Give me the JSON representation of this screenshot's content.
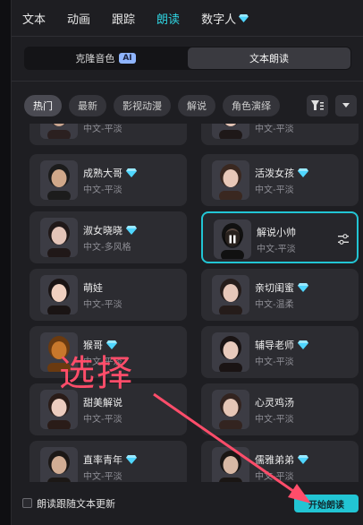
{
  "tabs": [
    {
      "label": "文本",
      "active": false
    },
    {
      "label": "动画",
      "active": false
    },
    {
      "label": "跟踪",
      "active": false
    },
    {
      "label": "朗读",
      "active": true
    },
    {
      "label": "数字人",
      "active": false,
      "premium_icon": "diamond-icon"
    }
  ],
  "segment": {
    "clone_label": "克隆音色",
    "ai_badge": "AI",
    "tts_label": "文本朗读",
    "active": "文本朗读"
  },
  "chips": [
    "热门",
    "最新",
    "影视动漫",
    "解说",
    "角色演绎"
  ],
  "voices": [
    {
      "name": "",
      "sub": "中文-平淡",
      "premium": false,
      "avatar": "female-1",
      "partial": true
    },
    {
      "name": "",
      "sub": "中文-平淡",
      "premium": false,
      "avatar": "female-2",
      "partial": true
    },
    {
      "name": "成熟大哥",
      "sub": "中文-平淡",
      "premium": true,
      "avatar": "male-glasses"
    },
    {
      "name": "活泼女孩",
      "sub": "中文-平淡",
      "premium": true,
      "avatar": "female-3"
    },
    {
      "name": "淑女晓晓",
      "sub": "中文-多风格",
      "premium": true,
      "avatar": "female-4"
    },
    {
      "name": "解说小帅",
      "sub": "中文-平淡",
      "premium": false,
      "avatar": "male-dark",
      "selected": true
    },
    {
      "name": "萌娃",
      "sub": "中文-平淡",
      "premium": false,
      "avatar": "child"
    },
    {
      "name": "亲切闺蜜",
      "sub": "中文-温柔",
      "premium": true,
      "avatar": "female-5"
    },
    {
      "name": "猴哥",
      "sub": "中文-平淡",
      "premium": true,
      "avatar": "monkey"
    },
    {
      "name": "辅导老师",
      "sub": "中文-平淡",
      "premium": true,
      "avatar": "female-6"
    },
    {
      "name": "甜美解说",
      "sub": "中文-平淡",
      "premium": false,
      "avatar": "female-7"
    },
    {
      "name": "心灵鸡汤",
      "sub": "中文-平淡",
      "premium": false,
      "avatar": "female-8"
    },
    {
      "name": "直率青年",
      "sub": "中文-平淡",
      "premium": true,
      "avatar": "male-young"
    },
    {
      "name": "儒雅弟弟",
      "sub": "中文-平淡",
      "premium": true,
      "avatar": "male-2"
    }
  ],
  "bottom": {
    "checkbox_label": "朗读跟随文本更新",
    "start_button": "开始朗读"
  },
  "annotation": {
    "text": "选择",
    "color": "#ff4d6a"
  },
  "colors": {
    "accent": "#22c5d4",
    "premium": "#4fd6ff"
  }
}
